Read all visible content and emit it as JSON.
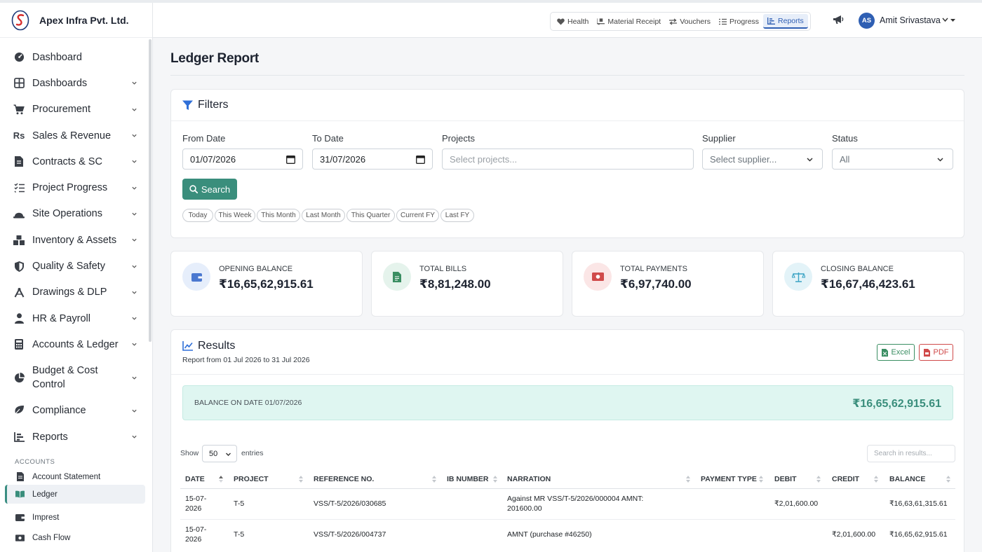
{
  "brand": {
    "name": "Apex Infra Pvt. Ltd."
  },
  "colors": {
    "accent": "#3a8e7c",
    "primary": "#2f5fb3"
  },
  "sidebar": {
    "items": [
      {
        "label": "Dashboard",
        "icon": "gauge-icon",
        "expandable": false
      },
      {
        "label": "Dashboards",
        "icon": "grid-icon",
        "expandable": true
      },
      {
        "label": "Procurement",
        "icon": "cart-icon",
        "expandable": true
      },
      {
        "label": "Sales & Revenue",
        "icon": "rupee-icon",
        "expandable": true
      },
      {
        "label": "Contracts & SC",
        "icon": "file-icon",
        "expandable": true
      },
      {
        "label": "Project Progress",
        "icon": "list-check-icon",
        "expandable": true
      },
      {
        "label": "Site Operations",
        "icon": "hard-hat-icon",
        "expandable": true
      },
      {
        "label": "Inventory & Assets",
        "icon": "boxes-icon",
        "expandable": true
      },
      {
        "label": "Quality & Safety",
        "icon": "shield-icon",
        "expandable": true
      },
      {
        "label": "Drawings & DLP",
        "icon": "compass-icon",
        "expandable": true
      },
      {
        "label": "HR & Payroll",
        "icon": "user-tie-icon",
        "expandable": true
      },
      {
        "label": "Accounts & Ledger",
        "icon": "calculator-icon",
        "expandable": true
      },
      {
        "label": "Budget & Cost Control",
        "icon": "pie-chart-icon",
        "expandable": true
      },
      {
        "label": "Compliance",
        "icon": "leaf-icon",
        "expandable": true
      },
      {
        "label": "Reports",
        "icon": "bar-chart-icon",
        "expandable": true
      }
    ],
    "section_label": "ACCOUNTS",
    "sub_items": [
      {
        "label": "Account Statement",
        "icon": "file-invoice-icon"
      },
      {
        "label": "Ledger",
        "icon": "book-open-icon"
      },
      {
        "label": "Imprest",
        "icon": "wallet-icon"
      },
      {
        "label": "Cash Flow",
        "icon": "money-bill-icon"
      }
    ]
  },
  "topnav": {
    "items": [
      {
        "label": "Health",
        "icon": "heart-pulse-icon"
      },
      {
        "label": "Material Receipt",
        "icon": "truck-loading-icon"
      },
      {
        "label": "Vouchers",
        "icon": "exchange-icon"
      },
      {
        "label": "Progress",
        "icon": "list-ol-icon"
      },
      {
        "label": "Reports",
        "icon": "chart-bar-icon"
      }
    ],
    "active": "Reports"
  },
  "user": {
    "initials": "AS",
    "name": "Amit Srivastava"
  },
  "page": {
    "title": "Ledger Report"
  },
  "filters": {
    "title": "Filters",
    "from_date": {
      "label": "From Date",
      "value": "01/07/2026"
    },
    "to_date": {
      "label": "To Date",
      "value": "31/07/2026"
    },
    "projects": {
      "label": "Projects",
      "placeholder": "Select projects..."
    },
    "supplier": {
      "label": "Supplier",
      "placeholder": "Select supplier..."
    },
    "status": {
      "label": "Status",
      "value": "All"
    },
    "search_label": "Search",
    "quick_ranges": [
      "Today",
      "This Week",
      "This Month",
      "Last Month",
      "This Quarter",
      "Current FY",
      "Last FY"
    ]
  },
  "stats": [
    {
      "label": "OPENING BALANCE",
      "value": "₹16,65,62,915.61",
      "icon": "wallet-icon",
      "color": "#4a78d0"
    },
    {
      "label": "TOTAL BILLS",
      "value": "₹8,81,248.00",
      "icon": "file-invoice-icon",
      "color": "#3a8e62"
    },
    {
      "label": "TOTAL PAYMENTS",
      "value": "₹6,97,740.00",
      "icon": "money-bill-icon",
      "color": "#d04a4a"
    },
    {
      "label": "CLOSING BALANCE",
      "value": "₹16,67,46,423.61",
      "icon": "balance-scale-icon",
      "color": "#3aa3c4"
    }
  ],
  "results": {
    "title": "Results",
    "subtitle": "Report from 01 Jul 2026 to 31 Jul 2026",
    "excel_label": "Excel",
    "pdf_label": "PDF",
    "balance_label": "BALANCE ON DATE 01/07/2026",
    "balance_value": "₹16,65,62,915.61",
    "show_label": "Show",
    "page_size": "50",
    "entries_label": "entries",
    "search_placeholder": "Search in results...",
    "columns": [
      "DATE",
      "PROJECT",
      "REFERENCE NO.",
      "IB NUMBER",
      "NARRATION",
      "PAYMENT TYPE",
      "DEBIT",
      "CREDIT",
      "BALANCE"
    ],
    "rows": [
      {
        "date": "15-07-2026",
        "project": "T-5",
        "ref": "VSS/T-5/2026/030685",
        "ib": "",
        "narration": "Against MR VSS/T-5/2026/000004 AMNT: 201600.00",
        "payment_type": "",
        "debit": "₹2,01,600.00",
        "credit": "",
        "balance": "₹16,63,61,315.61"
      },
      {
        "date": "15-07-2026",
        "project": "T-5",
        "ref": "VSS/T-5/2026/004737",
        "ib": "",
        "narration": "AMNT (purchase #46250)",
        "payment_type": "",
        "debit": "",
        "credit": "₹2,01,600.00",
        "balance": "₹16,65,62,915.61"
      }
    ]
  }
}
